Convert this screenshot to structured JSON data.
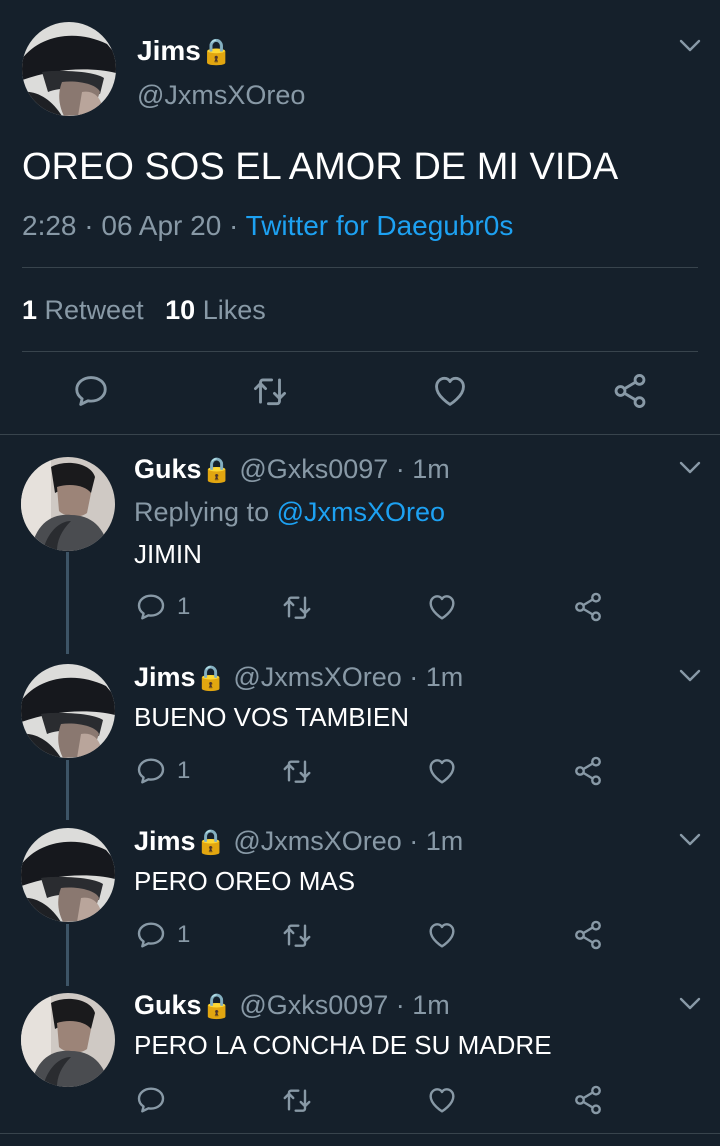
{
  "main_tweet": {
    "name": "Jims",
    "lock": "🔒",
    "handle": "@JxmsXOreo",
    "text": "OREO SOS EL AMOR DE MI VIDA",
    "time": "2:28",
    "sep1": "·",
    "date": "06 Apr 20",
    "sep2": "·",
    "source": "Twitter for Daegubr0s",
    "retweet_count": "1",
    "retweet_label": "Retweet",
    "likes_count": "10",
    "likes_label": "Likes"
  },
  "replies": [
    {
      "name": "Guks",
      "lock": "🔒",
      "handle_time": "@Gxks0097 · 1m",
      "replying_prefix": "Replying to",
      "replying_handle": "@JxmsXOreo",
      "text": "JIMIN",
      "reply_count": "1"
    },
    {
      "name": "Jims",
      "lock": "🔒",
      "handle_time": "@JxmsXOreo · 1m",
      "text": "BUENO VOS TAMBIEN",
      "reply_count": "1"
    },
    {
      "name": "Jims",
      "lock": "🔒",
      "handle_time": "@JxmsXOreo · 1m",
      "text": "PERO OREO MAS",
      "reply_count": "1"
    },
    {
      "name": "Guks",
      "lock": "🔒",
      "handle_time": "@Gxks0097 · 1m",
      "text": "PERO LA CONCHA DE SU MADRE",
      "reply_count": ""
    }
  ],
  "icons": {
    "reply": "reply-icon",
    "retweet": "retweet-icon",
    "like": "heart-icon",
    "share": "share-icon",
    "more": "chevron-down-icon"
  },
  "colors": {
    "background": "#15202b",
    "muted": "#8899a6",
    "link": "#1da1f2",
    "divider": "#38444d"
  }
}
